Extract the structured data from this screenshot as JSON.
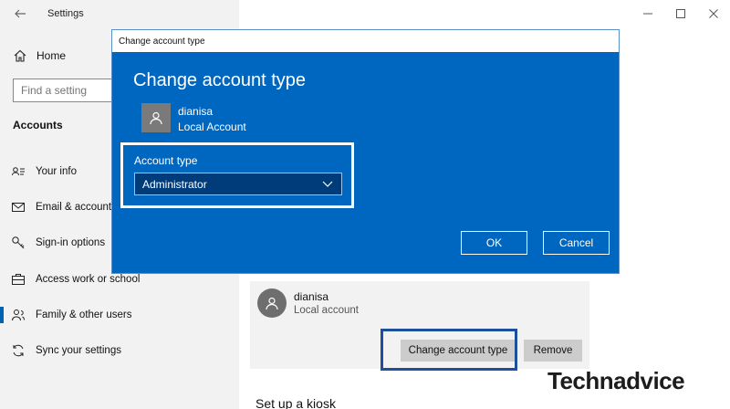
{
  "app": {
    "title": "Settings"
  },
  "sidebar": {
    "home_label": "Home",
    "search_placeholder": "Find a setting",
    "section_title": "Accounts",
    "items": [
      {
        "label": "Your info",
        "icon": "person-card-icon"
      },
      {
        "label": "Email & accounts",
        "icon": "email-icon"
      },
      {
        "label": "Sign-in options",
        "icon": "key-icon"
      },
      {
        "label": "Access work or school",
        "icon": "briefcase-icon"
      },
      {
        "label": "Family & other users",
        "icon": "people-icon",
        "active": true
      },
      {
        "label": "Sync your settings",
        "icon": "sync-icon"
      }
    ]
  },
  "main": {
    "user": {
      "name": "dianisa",
      "type": "Local account"
    },
    "change_button": "Change account type",
    "remove_button": "Remove",
    "kiosk_heading": "Set up a kiosk"
  },
  "dialog": {
    "window_title": "Change account type",
    "heading": "Change account type",
    "user": {
      "name": "dianisa",
      "type": "Local Account"
    },
    "account_type_label": "Account type",
    "account_type_value": "Administrator",
    "ok_label": "OK",
    "cancel_label": "Cancel"
  },
  "watermark": "Technadvice",
  "colors": {
    "accent": "#0067c0",
    "dialog_select": "#003b7a",
    "highlight_border": "#1e4f9c"
  }
}
